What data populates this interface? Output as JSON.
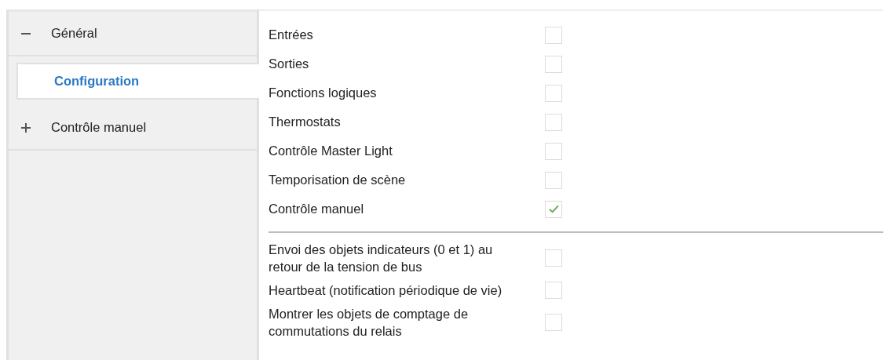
{
  "sidebar": {
    "items": [
      {
        "label": "Général",
        "expanded": true,
        "selected": false,
        "children": [
          {
            "label": "Configuration",
            "selected": true
          }
        ]
      },
      {
        "label": "Contrôle manuel",
        "expanded": false,
        "selected": false
      }
    ]
  },
  "settings": [
    {
      "label": "Entrées",
      "checked": false
    },
    {
      "label": "Sorties",
      "checked": false
    },
    {
      "label": "Fonctions logiques",
      "checked": false
    },
    {
      "label": "Thermostats",
      "checked": false
    },
    {
      "label": "Contrôle Master Light",
      "checked": false
    },
    {
      "label": "Temporisation de scène",
      "checked": false
    },
    {
      "label": "Contrôle manuel",
      "checked": true
    }
  ],
  "more_settings": [
    {
      "label": "Envoi des objets indicateurs (0 et 1) au retour de la tension de bus",
      "checked": false
    },
    {
      "label": "Heartbeat (notification périodique de vie)",
      "checked": false
    },
    {
      "label": "Montrer les objets de comptage de commutations du relais",
      "checked": false
    }
  ]
}
